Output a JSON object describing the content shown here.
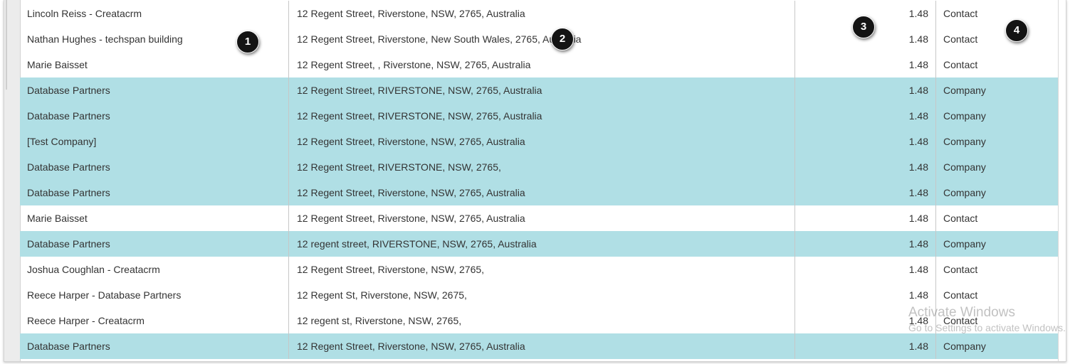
{
  "grid": {
    "rows": [
      {
        "name": "Lincoln Reiss - Creatacrm",
        "address": "12 Regent Street, Riverstone, NSW, 2765, Australia",
        "distance": "1.48",
        "type": "Contact"
      },
      {
        "name": "Nathan Hughes - techspan building",
        "address": "12 Regent Street, Riverstone, New South Wales, 2765, Australia",
        "distance": "1.48",
        "type": "Contact"
      },
      {
        "name": "Marie Baisset",
        "address": "12 Regent Street, , Riverstone, NSW, 2765, Australia",
        "distance": "1.48",
        "type": "Contact"
      },
      {
        "name": "Database Partners",
        "address": "12 Regent Street, RIVERSTONE, NSW, 2765, Australia",
        "distance": "1.48",
        "type": "Company"
      },
      {
        "name": "Database Partners",
        "address": "12 Regent Street, RIVERSTONE, NSW, 2765, Australia",
        "distance": "1.48",
        "type": "Company"
      },
      {
        "name": "[Test Company]",
        "address": "12 Regent Street, Riverstone, NSW, 2765, Australia",
        "distance": "1.48",
        "type": "Company"
      },
      {
        "name": "Database Partners",
        "address": "12 Regent Street, RIVERSTONE, NSW, 2765,",
        "distance": "1.48",
        "type": "Company"
      },
      {
        "name": "Database Partners",
        "address": "12 Regent Street, Riverstone, NSW, 2765, Australia",
        "distance": "1.48",
        "type": "Company"
      },
      {
        "name": "Marie Baisset",
        "address": "12 Regent Street, Riverstone, NSW, 2765, Australia",
        "distance": "1.48",
        "type": "Contact"
      },
      {
        "name": "Database Partners",
        "address": "12 regent street, RIVERSTONE, NSW, 2765, Australia",
        "distance": "1.48",
        "type": "Company"
      },
      {
        "name": "Joshua Coughlan - Creatacrm",
        "address": "12 Regent Street, Riverstone, NSW, 2765,",
        "distance": "1.48",
        "type": "Contact"
      },
      {
        "name": "Reece Harper - Database Partners",
        "address": "12 Regent St, Riverstone, NSW, 2675,",
        "distance": "1.48",
        "type": "Contact"
      },
      {
        "name": "Reece Harper - Creatacrm",
        "address": "12 regent st, Riverstone, NSW, 2765,",
        "distance": "1.48",
        "type": "Contact"
      },
      {
        "name": "Database Partners",
        "address": "12 Regent Street, Riverstone, NSW, 2765, Australia",
        "distance": "1.48",
        "type": "Company"
      }
    ]
  },
  "callouts": [
    "1",
    "2",
    "3",
    "4"
  ],
  "watermark": {
    "title": "Activate Windows",
    "subtitle": "Go to Settings to activate Windows."
  },
  "colors": {
    "company_row": "#b0dfe5",
    "contact_row": "#ffffff",
    "callout": "#141414"
  }
}
